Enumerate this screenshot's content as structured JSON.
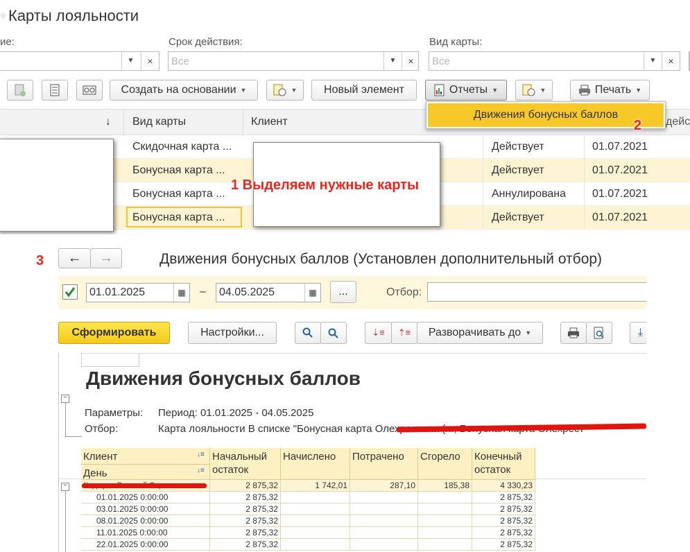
{
  "window": {
    "title": "Карты лояльности",
    "star": "☆"
  },
  "filters": {
    "name_label_partial": "ие:",
    "validity_label": "Срок действия:",
    "validity_placeholder": "Все",
    "card_type_label": "Вид карты:",
    "card_type_placeholder": "Все"
  },
  "toolbar": {
    "create_based_on": "Создать на основании",
    "new_element": "Новый элемент",
    "reports": "Отчеты",
    "print": "Печать"
  },
  "reports_menu": {
    "item": "Движения бонусных баллов"
  },
  "grid": {
    "columns": [
      "Вид карты",
      "Клиент"
    ],
    "sort_arrow": "↓",
    "right_header_partial": "дейс",
    "rows": [
      {
        "type": "Скидочная карта ...",
        "status": "Действует",
        "date": "01.07.2021",
        "highlight": false
      },
      {
        "type": "Бонусная карта ...",
        "status": "Действует",
        "date": "01.07.2021",
        "highlight": true
      },
      {
        "type": "Бонусная карта ...",
        "status": "Аннулирована",
        "date": "01.07.2021",
        "highlight": false
      },
      {
        "type": "Бонусная карта ...",
        "status": "Действует",
        "date": "01.07.2021",
        "highlight": true
      }
    ]
  },
  "annotations": {
    "step1": "1 Выделяем нужные карты",
    "step2": "2",
    "step3": "3"
  },
  "report_window": {
    "title": "Движения бонусных баллов (Установлен дополнительный отбор)",
    "date_from": "01.01.2025",
    "date_dash": "–",
    "date_to": "04.05.2025",
    "ellipsis": "...",
    "filter_label": "Отбор:",
    "generate_button": "Сформировать",
    "settings_button": "Настройки...",
    "expand_to": "Разворачивать до"
  },
  "report": {
    "title": "Движения бонусных баллов",
    "params_label": "Параметры:",
    "params_value": "Период: 01.01.2025 - 04.05.2025",
    "filter_label": "Отбор:",
    "filter_value": "Карта лояльности В списке \"Бонусная карта Олехрестила (п., Бонусная карта Олехрест",
    "columns": {
      "client": "Клиент",
      "day": "День",
      "opening_line1": "Начальный",
      "opening_line2": "остаток",
      "accrued": "Начислено",
      "spent": "Потрачено",
      "expired": "Сгорело",
      "closing_line1": "Конечный",
      "closing_line2": "остаток"
    },
    "group_row": {
      "client": "Кадыров Виталий Сергеевич",
      "opening": "2 875,32",
      "accrued": "1 742,01",
      "spent": "287,10",
      "expired": "185,38",
      "closing": "4 330,23"
    },
    "detail_rows": [
      {
        "day": "01.01.2025 0:00:00",
        "opening": "2 875,32",
        "closing": "2 875,32"
      },
      {
        "day": "03.01.2025 0:00:00",
        "opening": "2 875,32",
        "closing": "2 875,32"
      },
      {
        "day": "08.01.2025 0:00:00",
        "opening": "2 875,32",
        "closing": "2 875,32"
      },
      {
        "day": "11.01.2025 0:00:00",
        "opening": "2 875,32",
        "closing": "2 875,32"
      },
      {
        "day": "22.01.2025 0:00:00",
        "opening": "2 875,32",
        "closing": "2 875,32"
      }
    ]
  },
  "colors": {
    "accent_yellow": "#f7c928",
    "row_highlight": "#fdf4d3",
    "annotation_red": "#e8261c"
  }
}
